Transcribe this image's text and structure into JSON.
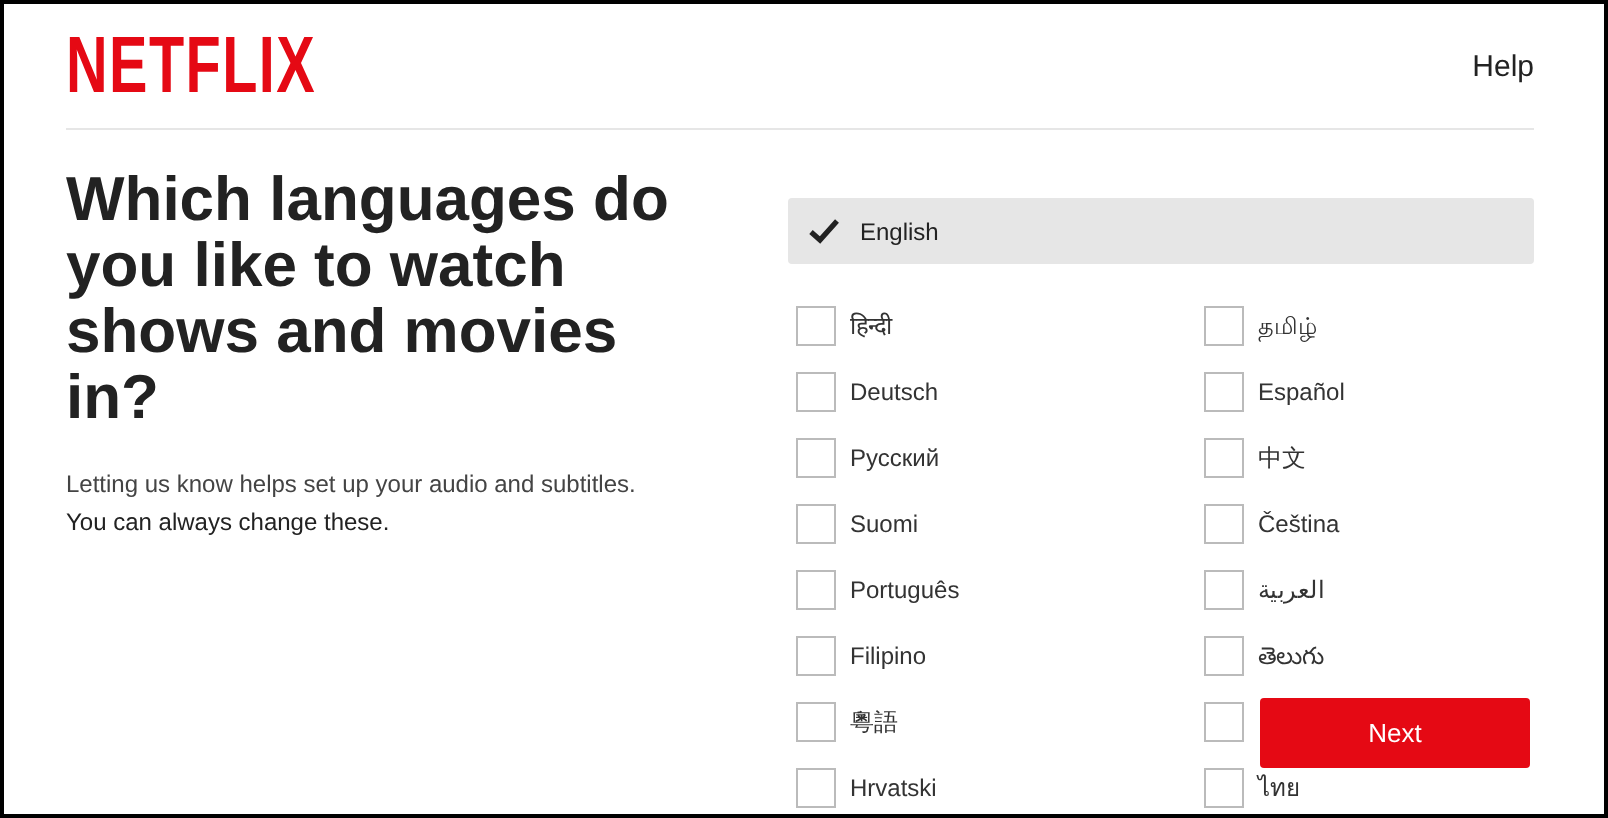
{
  "header": {
    "logo": "NETFLIX",
    "help_link": "Help"
  },
  "intro": {
    "heading": "Which languages do you like to watch shows and movies in?",
    "description": "Letting us know helps set up your audio and subtitles.",
    "note": "You can always change these."
  },
  "selected_language": {
    "label": "English",
    "checked": true
  },
  "languages": [
    {
      "label": "हिन्दी",
      "checked": false
    },
    {
      "label": "தமிழ்",
      "checked": false
    },
    {
      "label": "Deutsch",
      "checked": false
    },
    {
      "label": "Español",
      "checked": false
    },
    {
      "label": "Русский",
      "checked": false
    },
    {
      "label": "中文",
      "checked": false
    },
    {
      "label": "Suomi",
      "checked": false
    },
    {
      "label": "Čeština",
      "checked": false
    },
    {
      "label": "Português",
      "checked": false
    },
    {
      "label": "العربية",
      "checked": false
    },
    {
      "label": "Filipino",
      "checked": false
    },
    {
      "label": "తెలుగు",
      "checked": false
    },
    {
      "label": "粵語",
      "checked": false
    },
    {
      "checked": false
    },
    {
      "label": "Hrvatski",
      "checked": false
    },
    {
      "label": "ไทย",
      "checked": false
    }
  ],
  "next_button": "Next"
}
